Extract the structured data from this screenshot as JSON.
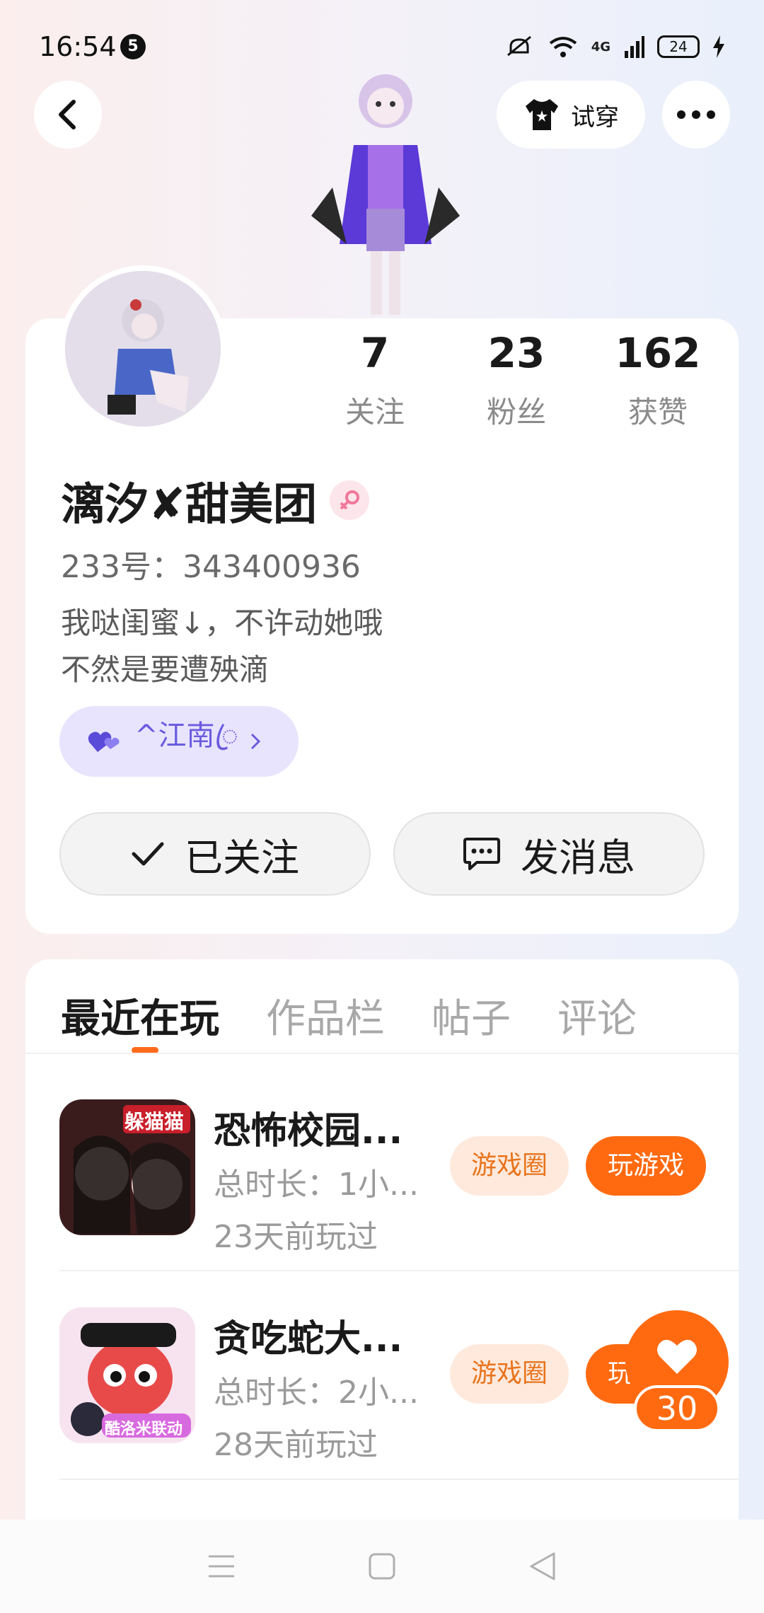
{
  "status_bar": {
    "time": "16:54",
    "notification_count": "5",
    "network": "4G",
    "battery": "24"
  },
  "header": {
    "tryon_label": "试穿"
  },
  "profile": {
    "stats": [
      {
        "value": "7",
        "label": "关注"
      },
      {
        "value": "23",
        "label": "粉丝"
      },
      {
        "value": "162",
        "label": "获赞"
      }
    ],
    "username": "漓汐✘甜美团",
    "user_id": "233号：343400936",
    "bio_line1": "我哒闺蜜↓，不许动她哦",
    "bio_line2": "不然是要遭殃滴",
    "bestie_name": "^江南ꦿ",
    "follow_label": "已关注",
    "message_label": "发消息"
  },
  "tabs": [
    {
      "label": "最近在玩"
    },
    {
      "label": "作品栏"
    },
    {
      "label": "帖子"
    },
    {
      "label": "评论"
    }
  ],
  "games": [
    {
      "title": "恐怖校园...",
      "duration": "总时长：1小...",
      "last_played": "23天前玩过",
      "thumb_text": "躲猫猫",
      "circle_label": "游戏圈",
      "play_label": "玩游戏"
    },
    {
      "title": "贪吃蛇大...",
      "duration": "总时长：2小...",
      "last_played": "28天前玩过",
      "thumb_text": "酷洛米联动",
      "circle_label": "游戏圈",
      "play_label": "玩游戏"
    }
  ],
  "like": {
    "count": "30"
  },
  "colors": {
    "accent": "#ff6a10",
    "accent_light": "#ffe9dc",
    "bestie": "#6b5ce0"
  }
}
